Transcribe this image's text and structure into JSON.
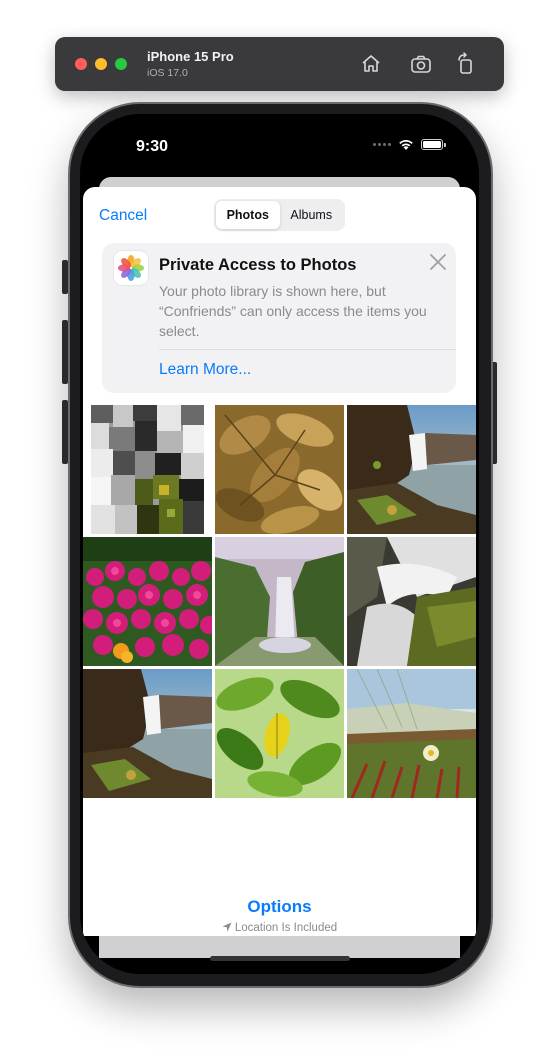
{
  "simulator": {
    "device_name": "iPhone 15 Pro",
    "os_version": "iOS 17.0",
    "buttons": [
      "home-icon",
      "screenshot-icon",
      "rotate-icon"
    ]
  },
  "status_bar": {
    "time": "9:30"
  },
  "picker": {
    "cancel_label": "Cancel",
    "tabs": [
      {
        "label": "Photos",
        "selected": true
      },
      {
        "label": "Albums",
        "selected": false
      }
    ],
    "notice": {
      "title": "Private Access to Photos",
      "body": "Your photo library is shown here, but “Confriends” can only access the items you select.",
      "link": "Learn More..."
    },
    "photos": [
      {
        "name": "pixelated-abstract"
      },
      {
        "name": "sepia-leaves"
      },
      {
        "name": "waterfall-cliff-coast"
      },
      {
        "name": "magenta-flowers"
      },
      {
        "name": "waterfall-valley"
      },
      {
        "name": "waterfall-long-exposure"
      },
      {
        "name": "waterfall-cliff-coast-2"
      },
      {
        "name": "green-leaves-sunlit"
      },
      {
        "name": "ice-plant-dunes"
      }
    ],
    "options_label": "Options",
    "location_text": "Location Is Included"
  },
  "colors": {
    "accent": "#0a7aff",
    "secondary_text": "#8a8a8e"
  }
}
